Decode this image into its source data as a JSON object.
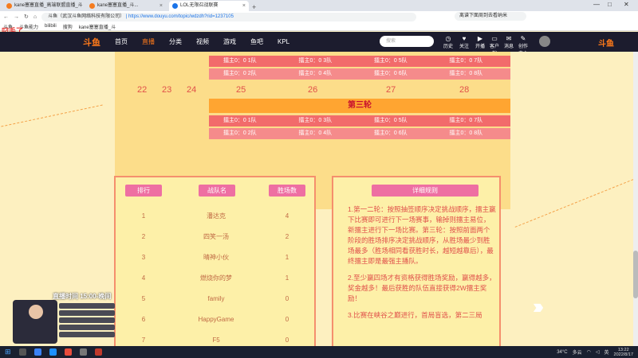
{
  "browser": {
    "tabs": [
      {
        "label": "kane塞塞直播_高端联盟直播_斗鱼直..."
      },
      {
        "label": "kane塞塞直播_斗..."
      },
      {
        "label": "LOL无限召战联赛"
      }
    ],
    "url_host": "斗鱼（武汉斗鱼网络科技有限公司）",
    "url_path": "https://www.douyu.com/topic/wdzdh?rid=1237105",
    "search_text": "离谱下面周到去看纳米",
    "bookmarks": [
      "斗鱼",
      "斗鱼能力",
      "bilibili",
      "搜狗",
      "kane塞塞直播_斗"
    ]
  },
  "site": {
    "logo": "斗鱼",
    "nav": [
      "首页",
      "直播",
      "分类",
      "视频",
      "游戏",
      "鱼吧",
      "KPL"
    ],
    "search_placeholder": "搜索",
    "icons": [
      "历史",
      "关注",
      "开播",
      "客户端",
      "消息",
      "创作中心"
    ]
  },
  "bracket": {
    "days": [
      "22",
      "23",
      "24",
      "25",
      "26",
      "27",
      "28"
    ],
    "round_title": "第三轮",
    "top_rows": [
      [
        "擂主0：0 1队",
        "擂主0：0 3队",
        "擂主0：0 5队",
        "擂主0：0 7队"
      ],
      [
        "擂主0：0 2队",
        "擂主0：0 4队",
        "擂主0：0 6队",
        "擂主0：0 8队"
      ]
    ],
    "round3_rows": [
      [
        "擂主0：0 1队",
        "擂主0：0 3队",
        "擂主0：0 5队",
        "擂主0：0 7队"
      ],
      [
        "擂主0：0 2队",
        "擂主0：0 4队",
        "擂主0：0 6队",
        "擂主0：0 8队"
      ]
    ]
  },
  "ranking": {
    "headers": [
      "排行",
      "战队名",
      "胜场数"
    ],
    "rows": [
      {
        "rank": "1",
        "team": "潘达克",
        "wins": "4"
      },
      {
        "rank": "2",
        "team": "四笑一汤",
        "wins": "2"
      },
      {
        "rank": "3",
        "team": "晴神小伙",
        "wins": "1"
      },
      {
        "rank": "4",
        "team": "燃烧你的梦",
        "wins": "1"
      },
      {
        "rank": "5",
        "team": "family",
        "wins": "0"
      },
      {
        "rank": "6",
        "team": "HappyGame",
        "wins": "0"
      },
      {
        "rank": "7",
        "team": "F5",
        "wins": "0"
      }
    ]
  },
  "rules": {
    "title": "详细规则",
    "paragraphs": [
      "1.第一二轮：按照抽签顺序决定挑战顺序，擂主赢下比赛即可进行下一场赛事，输掉则擂主易位，新擂主进行下一场比赛。第三轮：按照前面两个阶段的胜场排序决定挑战顺序，从胜场最少到胜场最多（胜场相同看获胜时长，越短越靠后），最终擂主即是最强主播队。",
      "2.至少赢四场才有资格获得胜场奖励，赢得越多，奖金越多！最后获胜的队伍直接获得2W擂主奖励！",
      "3.比赛在峡谷之巅进行，首局盲选，第二三局"
    ]
  },
  "overlay": {
    "watermark": "叼毛了",
    "schedule": "直播时间 15:00-晚间"
  },
  "taskbar": {
    "temp": "34°C",
    "weather": "多云",
    "lang": "英",
    "time": "13:22",
    "date": "2022/8/17"
  },
  "colors": {
    "accent": "#ff7a1a",
    "row_red": "#f26b6b",
    "header_pink": "#ee6fa2",
    "panel_bg": "#fdf0a8"
  }
}
